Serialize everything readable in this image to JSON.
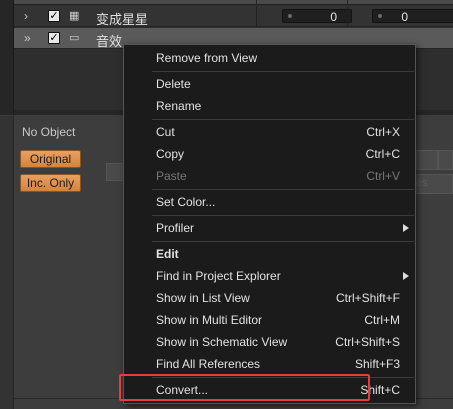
{
  "tree": {
    "rows": [
      {
        "name": "变成星星",
        "checked": "✓",
        "icon": "grid-icon",
        "values": [
          "0",
          "0"
        ],
        "selected": false
      },
      {
        "name": "音效",
        "checked": "✓",
        "icon": "folder-icon",
        "values": [],
        "selected": true
      }
    ]
  },
  "properties": {
    "title": "No Object",
    "buttons": {
      "original": "Original",
      "inc_only": "Inc. Only"
    },
    "ghost_label": "es"
  },
  "context_menu": {
    "items": [
      {
        "label": "Remove from View",
        "shortcut": ""
      },
      {
        "label": "Delete",
        "shortcut": ""
      },
      {
        "label": "Rename",
        "shortcut": ""
      },
      {
        "label": "Cut",
        "shortcut": "Ctrl+X"
      },
      {
        "label": "Copy",
        "shortcut": "Ctrl+C"
      },
      {
        "label": "Paste",
        "shortcut": "Ctrl+V",
        "disabled": true
      },
      {
        "label": "Set Color...",
        "shortcut": ""
      },
      {
        "label": "Profiler",
        "shortcut": "",
        "submenu": true
      },
      {
        "label": "Edit",
        "shortcut": "",
        "bold": true
      },
      {
        "label": "Find in Project Explorer",
        "shortcut": "",
        "submenu": true
      },
      {
        "label": "Show in List View",
        "shortcut": "Ctrl+Shift+F"
      },
      {
        "label": "Show in Multi Editor",
        "shortcut": "Ctrl+M"
      },
      {
        "label": "Show in Schematic View",
        "shortcut": "Ctrl+Shift+S"
      },
      {
        "label": "Find All References",
        "shortcut": "Shift+F3"
      },
      {
        "label": "Convert...",
        "shortcut": "Shift+C"
      }
    ],
    "highlight_color": "#e43d3d"
  },
  "colors": {
    "accent_orange": "#e09a55",
    "menu_bg": "#1b1b1b",
    "selected_row": "#5a5a5a"
  }
}
